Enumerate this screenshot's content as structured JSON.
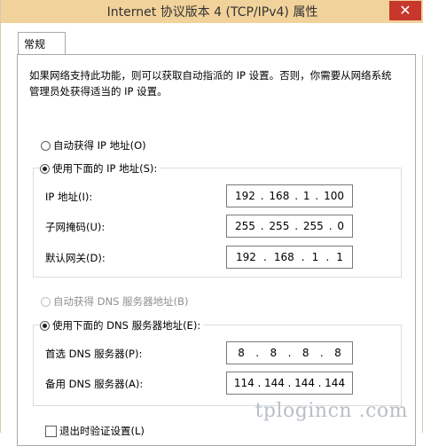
{
  "window": {
    "title": "Internet 协议版本 4 (TCP/IPv4) 属性",
    "close_glyph": "✕"
  },
  "tabs": [
    {
      "label": "常规",
      "selected": true
    }
  ],
  "description": "如果网络支持此功能，则可以获取自动指派的 IP 设置。否则，你需要从网络系统管理员处获得适当的 IP 设置。",
  "ip_section": {
    "auto_option": {
      "label": "自动获得 IP 地址(O)",
      "selected": false,
      "enabled": true
    },
    "manual_option": {
      "label": "使用下面的 IP 地址(S):",
      "selected": true,
      "enabled": true
    },
    "fields": [
      {
        "label": "IP 地址(I):",
        "octets": [
          "192",
          "168",
          "1",
          "100"
        ]
      },
      {
        "label": "子网掩码(U):",
        "octets": [
          "255",
          "255",
          "255",
          "0"
        ]
      },
      {
        "label": "默认网关(D):",
        "octets": [
          "192",
          "168",
          "1",
          "1"
        ]
      }
    ]
  },
  "dns_section": {
    "auto_option": {
      "label": "自动获得 DNS 服务器地址(B)",
      "selected": false,
      "enabled": false
    },
    "manual_option": {
      "label": "使用下面的 DNS 服务器地址(E):",
      "selected": true,
      "enabled": true
    },
    "fields": [
      {
        "label": "首选 DNS 服务器(P):",
        "octets": [
          "8",
          "8",
          "8",
          "8"
        ]
      },
      {
        "label": "备用 DNS 服务器(A):",
        "octets": [
          "114",
          "144",
          "144",
          "144"
        ]
      }
    ]
  },
  "validate_on_exit": {
    "label": "退出时验证设置(L)",
    "checked": false
  },
  "watermark": "tplogincn .com",
  "colors": {
    "titlebar": "#f1d29b",
    "close_button": "#c7372b"
  }
}
